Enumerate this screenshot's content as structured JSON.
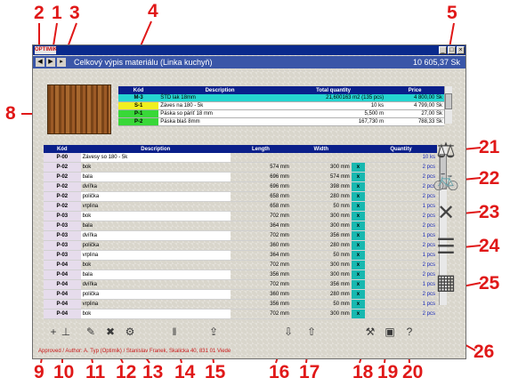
{
  "app": {
    "logo_text": "OPTIMIK",
    "window_title": "Celkový výpis materiálu (Linka kuchyň)",
    "total_price": "10 605,37 Sk",
    "nav_back": "◀",
    "nav_forward": "▶",
    "nav_menu": "▸",
    "win_minimize": "_",
    "win_maximize": "□",
    "win_close": "×"
  },
  "callouts": [
    "1",
    "2",
    "3",
    "4",
    "5",
    "6",
    "7",
    "8",
    "9",
    "10",
    "11",
    "12",
    "13",
    "14",
    "15",
    "16",
    "17",
    "18",
    "19",
    "20",
    "21",
    "22",
    "23",
    "24",
    "25",
    "26"
  ],
  "materials": {
    "headers": {
      "code": "Kód",
      "description": "Description",
      "total_quantity": "Total quantity",
      "price": "Price"
    },
    "rows": [
      {
        "code": "M-3",
        "description": "ŠTD lak 18mm",
        "total_quantity": "21,600163 m2 (135 pcs)",
        "price": "4 800,00 Sk",
        "color": "#25d5d0"
      },
      {
        "code": "S-1",
        "description": "Záves na 180 - 5k",
        "total_quantity": "10 ks",
        "price": "4 799,00 Sk",
        "color": "#f0f020"
      },
      {
        "code": "P-1",
        "description": "Páska so páriť 18 mm",
        "total_quantity": "5,500 m",
        "price": "27,00 Sk",
        "color": "#38d838"
      },
      {
        "code": "P-2",
        "description": "Páska blaš 8mm",
        "total_quantity": "167,730 m",
        "price": "788,33 Sk",
        "color": "#38d838"
      }
    ]
  },
  "items": {
    "headers": {
      "code": "Kód",
      "description": "Description",
      "length": "Length",
      "width": "Width",
      "quantity": "Quantity"
    },
    "rows": [
      {
        "code": "P-00",
        "description": "Závesy so 180 - 5k",
        "length": "",
        "width": "",
        "x": false,
        "quantity": "10 ks"
      },
      {
        "code": "P-02",
        "description": "bok",
        "length": "574 mm",
        "width": "300 mm",
        "x": true,
        "quantity": "2 pcs"
      },
      {
        "code": "P-02",
        "description": "bala",
        "length": "696 mm",
        "width": "574 mm",
        "x": true,
        "quantity": "2 pcs"
      },
      {
        "code": "P-02",
        "description": "dvířka",
        "length": "696 mm",
        "width": "398 mm",
        "x": true,
        "quantity": "2 pcs"
      },
      {
        "code": "P-02",
        "description": "polička",
        "length": "658 mm",
        "width": "280 mm",
        "x": true,
        "quantity": "2 pcs"
      },
      {
        "code": "P-02",
        "description": "vrplina",
        "length": "658 mm",
        "width": "50 mm",
        "x": true,
        "quantity": "1 pcs"
      },
      {
        "code": "P-03",
        "description": "bok",
        "length": "702 mm",
        "width": "300 mm",
        "x": true,
        "quantity": "2 pcs"
      },
      {
        "code": "P-03",
        "description": "bala",
        "length": "364 mm",
        "width": "300 mm",
        "x": true,
        "quantity": "2 pcs"
      },
      {
        "code": "P-03",
        "description": "dvířka",
        "length": "702 mm",
        "width": "356 mm",
        "x": true,
        "quantity": "1 pcs"
      },
      {
        "code": "P-03",
        "description": "polička",
        "length": "360 mm",
        "width": "280 mm",
        "x": true,
        "quantity": "2 pcs"
      },
      {
        "code": "P-03",
        "description": "vrplina",
        "length": "364 mm",
        "width": "50 mm",
        "x": true,
        "quantity": "1 pcs"
      },
      {
        "code": "P-04",
        "description": "bok",
        "length": "702 mm",
        "width": "300 mm",
        "x": true,
        "quantity": "2 pcs"
      },
      {
        "code": "P-04",
        "description": "bala",
        "length": "356 mm",
        "width": "300 mm",
        "x": true,
        "quantity": "2 pcs"
      },
      {
        "code": "P-04",
        "description": "dvířka",
        "length": "702 mm",
        "width": "356 mm",
        "x": true,
        "quantity": "1 pcs"
      },
      {
        "code": "P-04",
        "description": "polička",
        "length": "360 mm",
        "width": "280 mm",
        "x": true,
        "quantity": "2 pcs"
      },
      {
        "code": "P-04",
        "description": "vrplina",
        "length": "356 mm",
        "width": "50 mm",
        "x": true,
        "quantity": "1 pcs"
      },
      {
        "code": "P-04",
        "description": "bok",
        "length": "702 mm",
        "width": "300 mm",
        "x": true,
        "quantity": "2 pcs"
      }
    ]
  },
  "status_text": "Approved / Author: A. Typ (Optimik) / Stanislav Franek, Skalicka 40, 831 01 Viede",
  "icons": {
    "toolbar": [
      "add-item-icon",
      "cutting-icon",
      "edit-icon",
      "delete-icon",
      "settings-icon",
      "split-columns-icon",
      "export-icon",
      "import-icon",
      "export-list-icon",
      "tools-icon",
      "print-preview-icon",
      "help-icon"
    ],
    "side": [
      "scale-icon",
      "bicycle-icon",
      "scissors-icon",
      "layers-icon",
      "cabinet-icon"
    ]
  }
}
